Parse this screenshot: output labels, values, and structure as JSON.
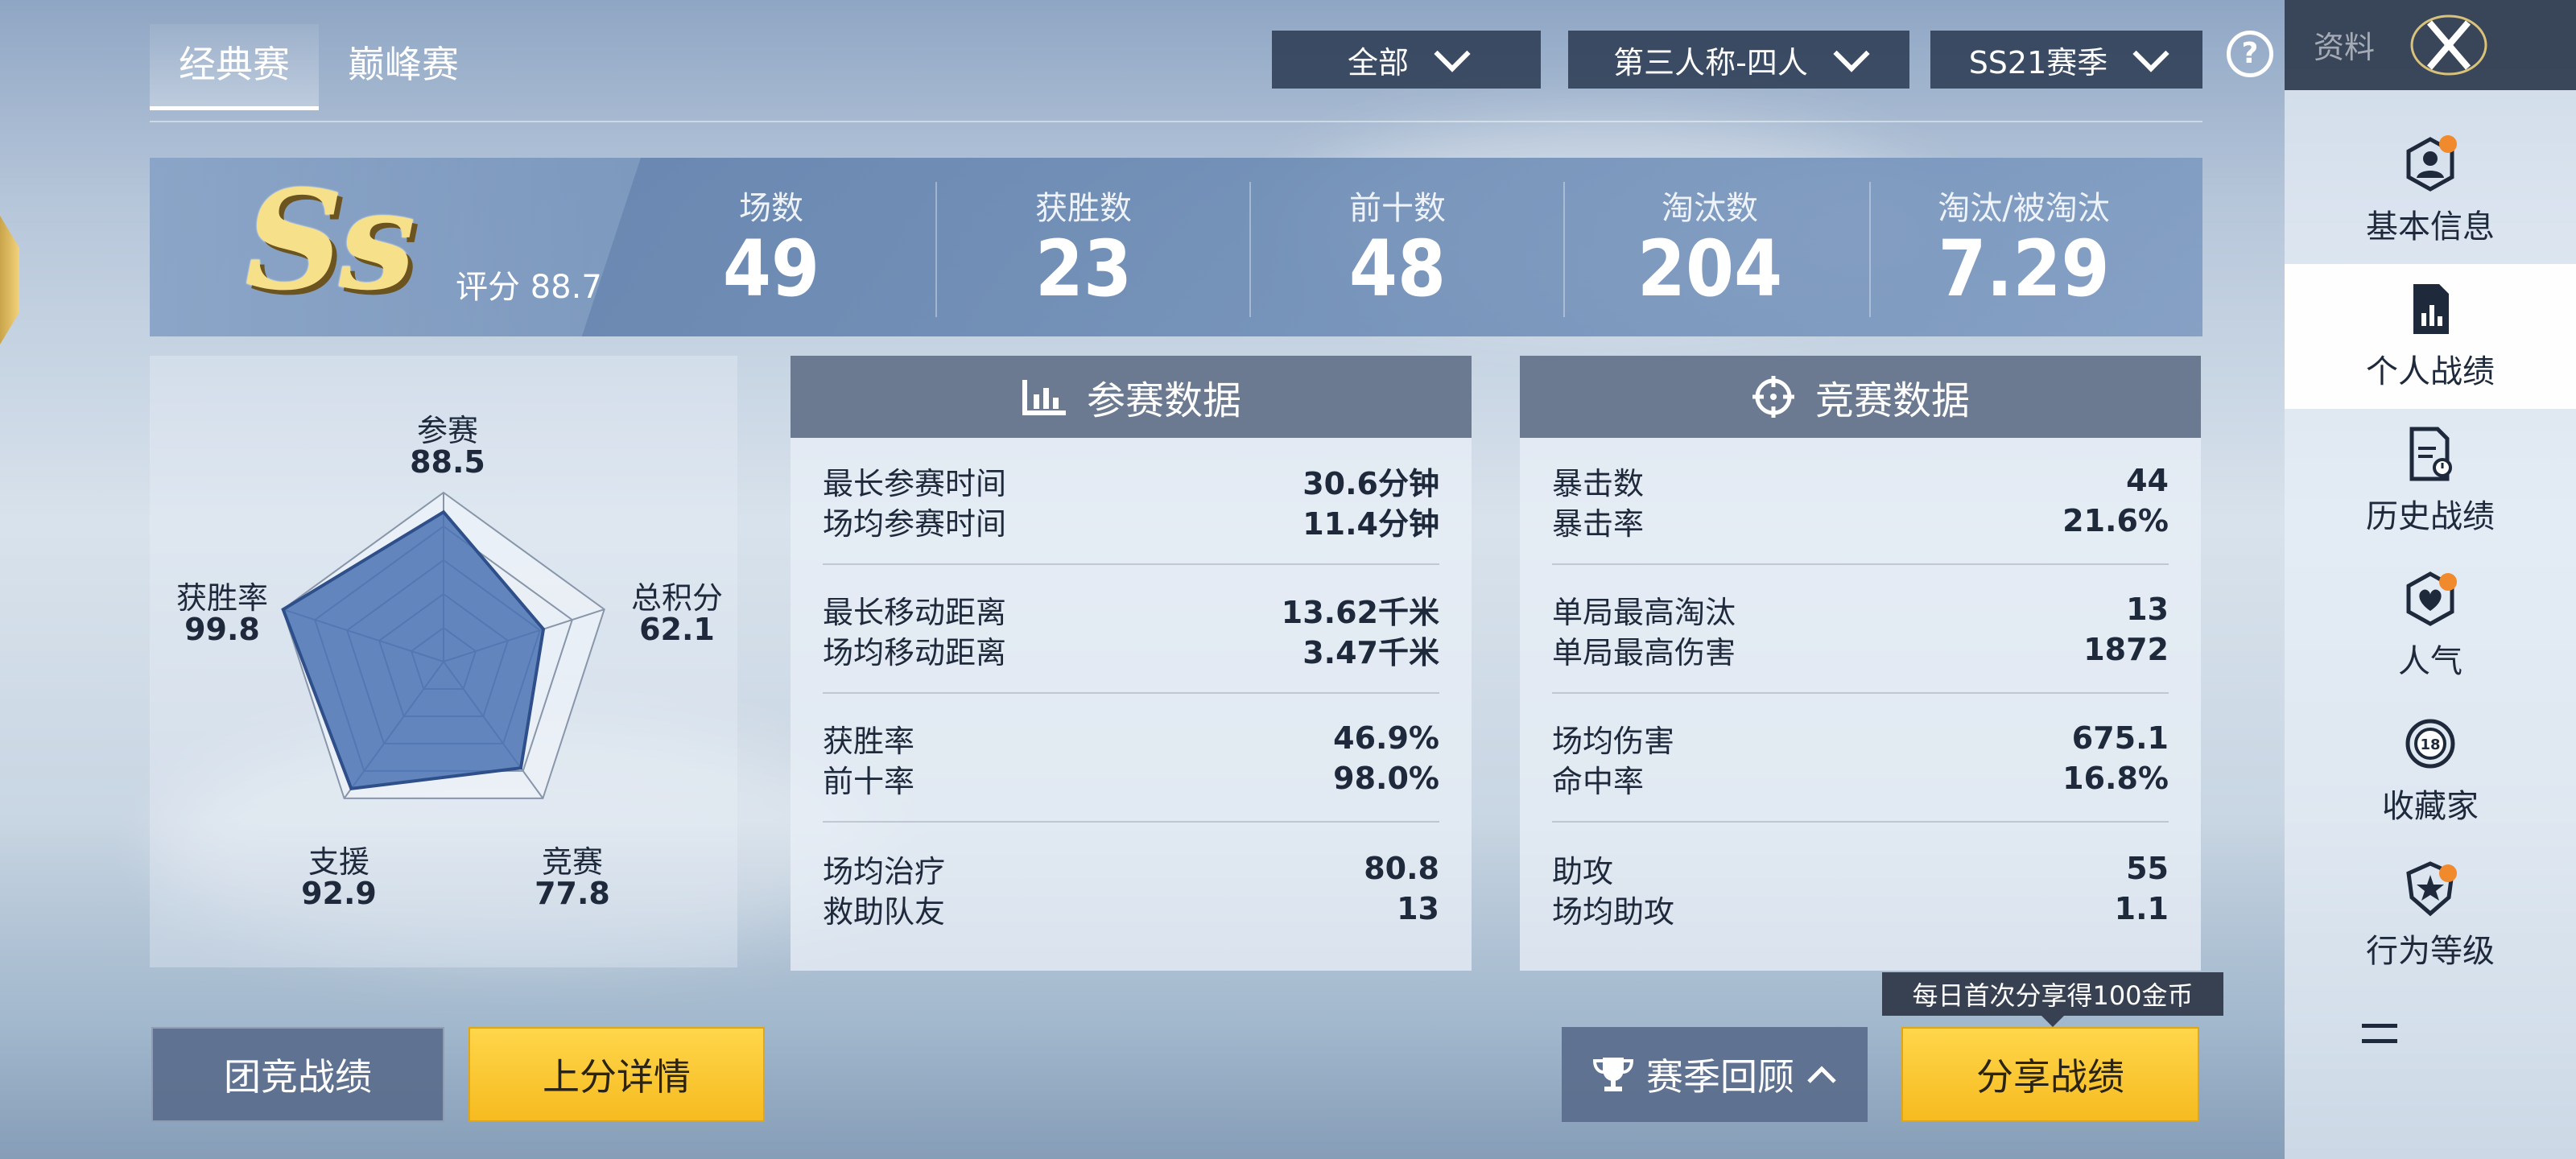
{
  "tabs": [
    {
      "label": "经典赛"
    },
    {
      "label": "巅峰赛"
    }
  ],
  "filters": {
    "mode": "全部",
    "perspective": "第三人称-四人",
    "season": "SS21赛季"
  },
  "help_label": "?",
  "side_panel": {
    "header_label": "资料",
    "items": [
      {
        "label": "基本信息",
        "icon": "profile-icon",
        "badge": true
      },
      {
        "label": "个人战绩",
        "icon": "stats-report-icon",
        "badge": false,
        "active": true
      },
      {
        "label": "历史战绩",
        "icon": "history-document-icon",
        "badge": false
      },
      {
        "label": "人气",
        "icon": "popularity-icon",
        "badge": true
      },
      {
        "label": "收藏家",
        "icon": "collector-icon",
        "badge": false,
        "level": "18"
      },
      {
        "label": "行为等级",
        "icon": "behavior-shield-icon",
        "badge": true
      }
    ]
  },
  "summary": {
    "grade": "Ss",
    "score_text": "评分 88.7",
    "stats": [
      {
        "label": "场数",
        "value": "49"
      },
      {
        "label": "获胜数",
        "value": "23"
      },
      {
        "label": "前十数",
        "value": "48"
      },
      {
        "label": "淘汰数",
        "value": "204"
      },
      {
        "label": "淘汰/被淘汰",
        "value": "7.29"
      }
    ]
  },
  "radar": {
    "axes": [
      {
        "label": "参赛",
        "value": "88.5",
        "num": 88.5
      },
      {
        "label": "总积分",
        "value": "62.1",
        "num": 62.1
      },
      {
        "label": "竞赛",
        "value": "77.8",
        "num": 77.8
      },
      {
        "label": "支援",
        "value": "92.9",
        "num": 92.9
      },
      {
        "label": "获胜率",
        "value": "99.8",
        "num": 99.8
      }
    ]
  },
  "participation": {
    "title": "参赛数据",
    "groups": [
      [
        {
          "k": "最长参赛时间",
          "v": "30.6分钟"
        },
        {
          "k": "场均参赛时间",
          "v": "11.4分钟"
        }
      ],
      [
        {
          "k": "最长移动距离",
          "v": "13.62千米"
        },
        {
          "k": "场均移动距离",
          "v": "3.47千米"
        }
      ],
      [
        {
          "k": "获胜率",
          "v": "46.9%"
        },
        {
          "k": "前十率",
          "v": "98.0%"
        }
      ],
      [
        {
          "k": "场均治疗",
          "v": "80.8"
        },
        {
          "k": "救助队友",
          "v": "13"
        }
      ]
    ]
  },
  "competition": {
    "title": "竞赛数据",
    "groups": [
      [
        {
          "k": "暴击数",
          "v": "44"
        },
        {
          "k": "暴击率",
          "v": "21.6%"
        }
      ],
      [
        {
          "k": "单局最高淘汰",
          "v": "13"
        },
        {
          "k": "单局最高伤害",
          "v": "1872"
        }
      ],
      [
        {
          "k": "场均伤害",
          "v": "675.1"
        },
        {
          "k": "命中率",
          "v": "16.8%"
        }
      ],
      [
        {
          "k": "助攻",
          "v": "55"
        },
        {
          "k": "场均助攻",
          "v": "1.1"
        }
      ]
    ]
  },
  "buttons": {
    "team": "团竞战绩",
    "rank_detail": "上分详情",
    "season_review": "赛季回顾",
    "share": "分享战绩",
    "share_tip": "每日首次分享得100金币"
  },
  "colors": {
    "accent_yellow": "#f6bb20",
    "badge_orange": "#f08a2c",
    "radar_fill": "#4a72b4"
  }
}
